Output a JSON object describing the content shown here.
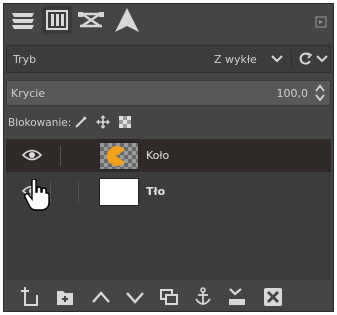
{
  "panel": {
    "tabs": [
      {
        "icon": "layers-stack-icon",
        "active": false
      },
      {
        "icon": "channels-icon",
        "active": true
      },
      {
        "icon": "paths-icon",
        "active": false
      },
      {
        "icon": "undo-history-icon",
        "active": false
      }
    ],
    "tab_menu_icon": "tab-menu-icon"
  },
  "mode": {
    "label": "Tryb",
    "value": "Z wykłe"
  },
  "opacity": {
    "label": "Krycie",
    "value": "100,0",
    "fraction": 1.0
  },
  "lock": {
    "label": "Blokowanie:",
    "items": [
      "lock-pixels-icon",
      "lock-position-icon",
      "lock-alpha-icon"
    ]
  },
  "layers": [
    {
      "name": "Koło",
      "visible": true,
      "selected": true,
      "thumb": "checker-orange-circle",
      "bold": false
    },
    {
      "name": "Tło",
      "visible": true,
      "selected": false,
      "thumb": "white",
      "bold": true
    }
  ],
  "toolbar": {
    "buttons": [
      "new-layer-icon",
      "new-layer-group-icon",
      "raise-layer-icon",
      "lower-layer-icon",
      "duplicate-layer-icon",
      "anchor-layer-icon",
      "merge-down-icon",
      "delete-layer-icon"
    ]
  },
  "colors": {
    "panel_bg": "#454545",
    "list_bg": "#3c3c3c",
    "selected_row": "#2f2a28",
    "icon": "#d8d8d8",
    "thumb_orange": "#f0a01a"
  }
}
